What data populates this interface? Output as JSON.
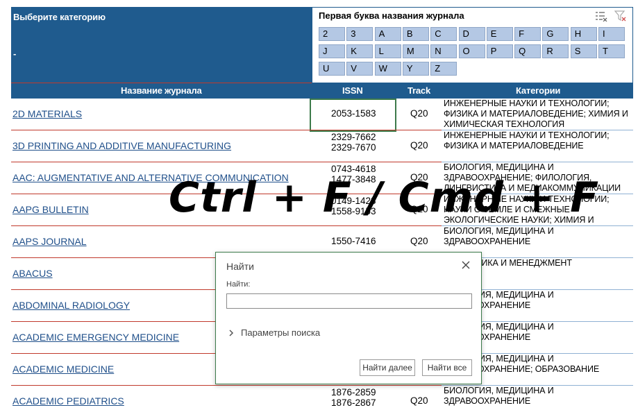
{
  "category_panel": {
    "title": "Выберите категорию",
    "selected": "-"
  },
  "letter_panel": {
    "title": "Первая буква названия журнала",
    "icons": [
      "clear-selection-icon",
      "clear-filter-icon"
    ],
    "letters": [
      "2",
      "3",
      "A",
      "B",
      "C",
      "D",
      "E",
      "F",
      "G",
      "H",
      "I",
      "J",
      "K",
      "L",
      "M",
      "N",
      "O",
      "P",
      "Q",
      "R",
      "S",
      "T",
      "U",
      "V",
      "W",
      "Y",
      "Z"
    ]
  },
  "table": {
    "headers": {
      "name": "Название журнала",
      "issn": "ISSN",
      "track": "Track",
      "categories": "Категории"
    },
    "rows": [
      {
        "name": "2D MATERIALS",
        "issn": [
          "2053-1583"
        ],
        "track": "Q20",
        "categories": [
          "ИНЖЕНЕРНЫЕ НАУКИ И ТЕХНОЛОГИИ;",
          "ФИЗИКА И МАТЕРИАЛОВЕДЕНИЕ; ХИМИЯ И",
          "ХИМИЧЕСКАЯ ТЕХНОЛОГИЯ"
        ]
      },
      {
        "name": "3D PRINTING AND ADDITIVE MANUFACTURING",
        "issn": [
          "2329-7662",
          "2329-7670"
        ],
        "track": "Q20",
        "categories": [
          "ИНЖЕНЕРНЫЕ НАУКИ И ТЕХНОЛОГИИ;",
          "ФИЗИКА И МАТЕРИАЛОВЕДЕНИЕ"
        ]
      },
      {
        "name": "AAC: AUGMENTATIVE AND ALTERNATIVE COMMUNICATION",
        "issn": [
          "0743-4618",
          "1477-3848"
        ],
        "track": "Q20",
        "categories": [
          "БИОЛОГИЯ, МЕДИЦИНА И",
          "ЗДРАВООХРАНЕНИЕ; ФИЛОЛОГИЯ,",
          "ЛИНГВИСТИКА И МЕДИАКОММУНИКАЦИИ"
        ]
      },
      {
        "name": "AAPG BULLETIN",
        "issn": [
          "0149-1423",
          "1558-9153"
        ],
        "track": "Q20",
        "categories": [
          "ИНЖЕНЕРНЫЕ НАУКИ И ТЕХНОЛОГИИ;",
          "НАУКИ О ЗЕМЛЕ И СМЕЖНЫЕ",
          "ЭКОЛОГИЧЕСКИЕ НАУКИ; ХИМИЯ И"
        ]
      },
      {
        "name": "AAPS JOURNAL",
        "issn": [
          "1550-7416"
        ],
        "track": "Q20",
        "categories": [
          "БИОЛОГИЯ, МЕДИЦИНА И",
          "ЗДРАВООХРАНЕНИЕ"
        ]
      },
      {
        "name": "ABACUS",
        "issn": [],
        "track": "",
        "categories": [
          "ЭКОНОМИКА И МЕНЕДЖМЕНТ"
        ]
      },
      {
        "name": "ABDOMINAL RADIOLOGY",
        "issn": [],
        "track": "",
        "categories": [
          "БИОЛОГИЯ, МЕДИЦИНА И",
          "ЗДРАВООХРАНЕНИЕ"
        ]
      },
      {
        "name": "ACADEMIC EMERGENCY MEDICINE",
        "issn": [],
        "track": "",
        "categories": [
          "БИОЛОГИЯ, МЕДИЦИНА И",
          "ЗДРАВООХРАНЕНИЕ"
        ]
      },
      {
        "name": "ACADEMIC MEDICINE",
        "issn": [],
        "track": "",
        "categories": [
          "БИОЛОГИЯ, МЕДИЦИНА И",
          "ЗДРАВООХРАНЕНИЕ; ОБРАЗОВАНИЕ"
        ]
      },
      {
        "name": "ACADEMIC PEDIATRICS",
        "issn": [
          "1876-2859",
          "1876-2867"
        ],
        "track": "Q20",
        "categories": [
          "БИОЛОГИЯ, МЕДИЦИНА И",
          "ЗДРАВООХРАНЕНИЕ"
        ]
      }
    ]
  },
  "overlay": {
    "text": "Ctrl + F / Cmd + F"
  },
  "find_dialog": {
    "title": "Найти",
    "field_label": "Найти:",
    "field_value": "",
    "options_label": "Параметры поиска",
    "find_next_label": "Найти далее",
    "find_all_label": "Найти все"
  },
  "colors": {
    "header_blue": "#1f5b8e",
    "letter_button": "#b4c8e4",
    "link_blue": "#1f4f8a",
    "row_divider_red": "#c0392b",
    "selection_green": "#3c7a4a"
  }
}
